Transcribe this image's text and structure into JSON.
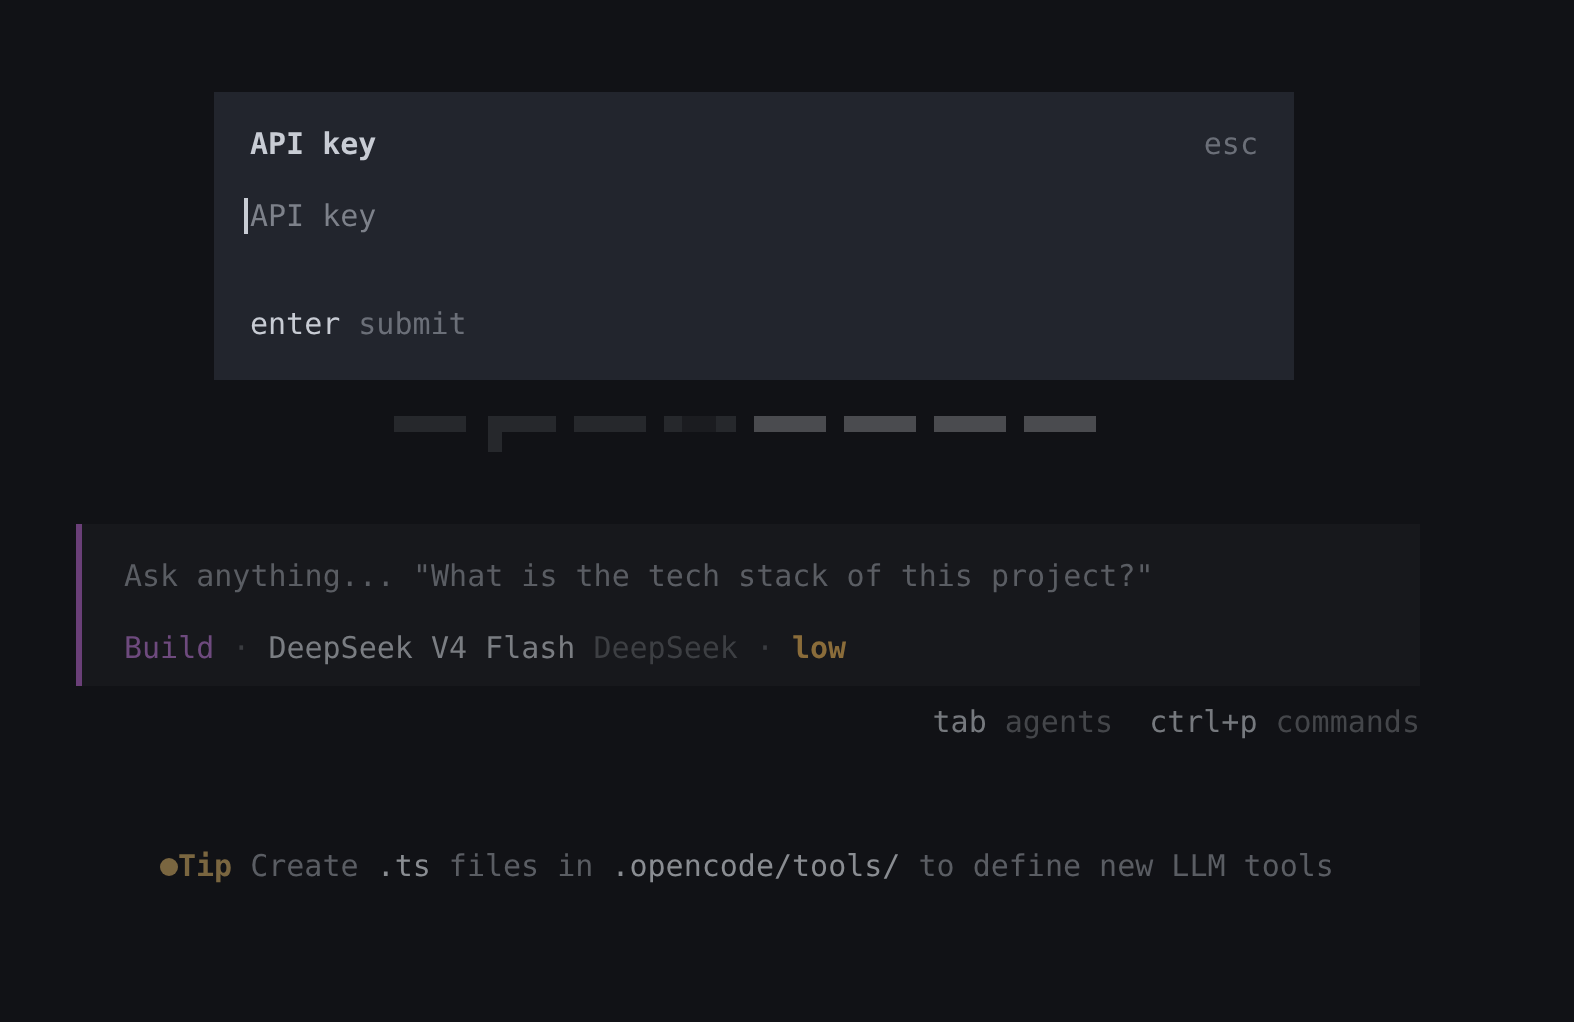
{
  "dialog": {
    "title": "API key",
    "close_hint": "esc",
    "field": {
      "placeholder": "API key"
    },
    "footer": {
      "key": "enter",
      "action": "submit"
    }
  },
  "prompt": {
    "placeholder": "Ask anything... \"What is the tech stack of this project?\"",
    "status": [
      {
        "kind": "agent",
        "text": "Build"
      },
      {
        "kind": "separator",
        "text": "·"
      },
      {
        "kind": "model",
        "text": "DeepSeek V4 Flash"
      },
      {
        "kind": "provider",
        "text": "DeepSeek"
      },
      {
        "kind": "separator",
        "text": "·"
      },
      {
        "kind": "variant",
        "text": "low"
      }
    ]
  },
  "hints": [
    {
      "key": "tab",
      "action": "agents"
    },
    {
      "key": "ctrl+p",
      "action": "commands"
    }
  ],
  "tip": {
    "label": "Tip",
    "text": "Create **.ts** files in **.opencode/tools/** to define new LLM tools"
  }
}
